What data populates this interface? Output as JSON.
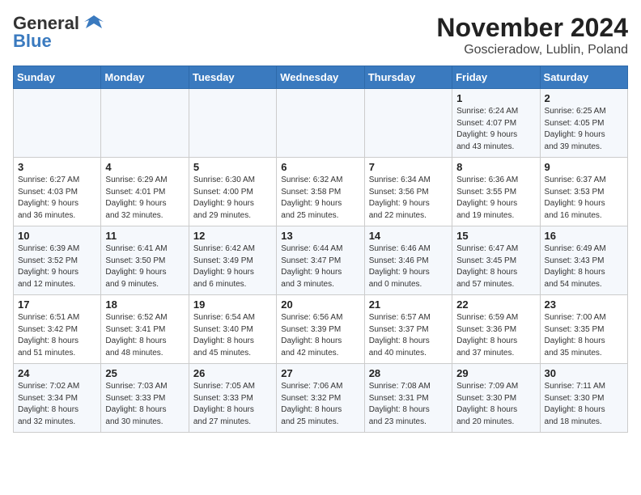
{
  "logo": {
    "line1": "General",
    "line2": "Blue"
  },
  "title": "November 2024",
  "location": "Goscieradow, Lublin, Poland",
  "days_of_week": [
    "Sunday",
    "Monday",
    "Tuesday",
    "Wednesday",
    "Thursday",
    "Friday",
    "Saturday"
  ],
  "weeks": [
    [
      {
        "day": "",
        "info": ""
      },
      {
        "day": "",
        "info": ""
      },
      {
        "day": "",
        "info": ""
      },
      {
        "day": "",
        "info": ""
      },
      {
        "day": "",
        "info": ""
      },
      {
        "day": "1",
        "info": "Sunrise: 6:24 AM\nSunset: 4:07 PM\nDaylight: 9 hours\nand 43 minutes."
      },
      {
        "day": "2",
        "info": "Sunrise: 6:25 AM\nSunset: 4:05 PM\nDaylight: 9 hours\nand 39 minutes."
      }
    ],
    [
      {
        "day": "3",
        "info": "Sunrise: 6:27 AM\nSunset: 4:03 PM\nDaylight: 9 hours\nand 36 minutes."
      },
      {
        "day": "4",
        "info": "Sunrise: 6:29 AM\nSunset: 4:01 PM\nDaylight: 9 hours\nand 32 minutes."
      },
      {
        "day": "5",
        "info": "Sunrise: 6:30 AM\nSunset: 4:00 PM\nDaylight: 9 hours\nand 29 minutes."
      },
      {
        "day": "6",
        "info": "Sunrise: 6:32 AM\nSunset: 3:58 PM\nDaylight: 9 hours\nand 25 minutes."
      },
      {
        "day": "7",
        "info": "Sunrise: 6:34 AM\nSunset: 3:56 PM\nDaylight: 9 hours\nand 22 minutes."
      },
      {
        "day": "8",
        "info": "Sunrise: 6:36 AM\nSunset: 3:55 PM\nDaylight: 9 hours\nand 19 minutes."
      },
      {
        "day": "9",
        "info": "Sunrise: 6:37 AM\nSunset: 3:53 PM\nDaylight: 9 hours\nand 16 minutes."
      }
    ],
    [
      {
        "day": "10",
        "info": "Sunrise: 6:39 AM\nSunset: 3:52 PM\nDaylight: 9 hours\nand 12 minutes."
      },
      {
        "day": "11",
        "info": "Sunrise: 6:41 AM\nSunset: 3:50 PM\nDaylight: 9 hours\nand 9 minutes."
      },
      {
        "day": "12",
        "info": "Sunrise: 6:42 AM\nSunset: 3:49 PM\nDaylight: 9 hours\nand 6 minutes."
      },
      {
        "day": "13",
        "info": "Sunrise: 6:44 AM\nSunset: 3:47 PM\nDaylight: 9 hours\nand 3 minutes."
      },
      {
        "day": "14",
        "info": "Sunrise: 6:46 AM\nSunset: 3:46 PM\nDaylight: 9 hours\nand 0 minutes."
      },
      {
        "day": "15",
        "info": "Sunrise: 6:47 AM\nSunset: 3:45 PM\nDaylight: 8 hours\nand 57 minutes."
      },
      {
        "day": "16",
        "info": "Sunrise: 6:49 AM\nSunset: 3:43 PM\nDaylight: 8 hours\nand 54 minutes."
      }
    ],
    [
      {
        "day": "17",
        "info": "Sunrise: 6:51 AM\nSunset: 3:42 PM\nDaylight: 8 hours\nand 51 minutes."
      },
      {
        "day": "18",
        "info": "Sunrise: 6:52 AM\nSunset: 3:41 PM\nDaylight: 8 hours\nand 48 minutes."
      },
      {
        "day": "19",
        "info": "Sunrise: 6:54 AM\nSunset: 3:40 PM\nDaylight: 8 hours\nand 45 minutes."
      },
      {
        "day": "20",
        "info": "Sunrise: 6:56 AM\nSunset: 3:39 PM\nDaylight: 8 hours\nand 42 minutes."
      },
      {
        "day": "21",
        "info": "Sunrise: 6:57 AM\nSunset: 3:37 PM\nDaylight: 8 hours\nand 40 minutes."
      },
      {
        "day": "22",
        "info": "Sunrise: 6:59 AM\nSunset: 3:36 PM\nDaylight: 8 hours\nand 37 minutes."
      },
      {
        "day": "23",
        "info": "Sunrise: 7:00 AM\nSunset: 3:35 PM\nDaylight: 8 hours\nand 35 minutes."
      }
    ],
    [
      {
        "day": "24",
        "info": "Sunrise: 7:02 AM\nSunset: 3:34 PM\nDaylight: 8 hours\nand 32 minutes."
      },
      {
        "day": "25",
        "info": "Sunrise: 7:03 AM\nSunset: 3:33 PM\nDaylight: 8 hours\nand 30 minutes."
      },
      {
        "day": "26",
        "info": "Sunrise: 7:05 AM\nSunset: 3:33 PM\nDaylight: 8 hours\nand 27 minutes."
      },
      {
        "day": "27",
        "info": "Sunrise: 7:06 AM\nSunset: 3:32 PM\nDaylight: 8 hours\nand 25 minutes."
      },
      {
        "day": "28",
        "info": "Sunrise: 7:08 AM\nSunset: 3:31 PM\nDaylight: 8 hours\nand 23 minutes."
      },
      {
        "day": "29",
        "info": "Sunrise: 7:09 AM\nSunset: 3:30 PM\nDaylight: 8 hours\nand 20 minutes."
      },
      {
        "day": "30",
        "info": "Sunrise: 7:11 AM\nSunset: 3:30 PM\nDaylight: 8 hours\nand 18 minutes."
      }
    ]
  ]
}
